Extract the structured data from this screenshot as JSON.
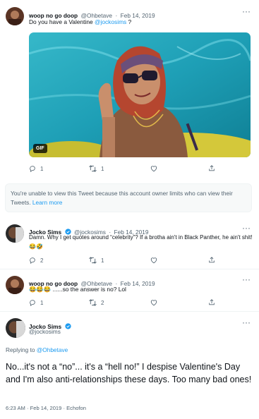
{
  "tweet1": {
    "display_name": "woop no go doop",
    "handle": "@Ohbetave",
    "date": "Feb 14, 2019",
    "text_before": "Do you have a Valentine ",
    "mention": "@jockosims",
    "text_after": " ?",
    "media_badge": "GIF",
    "reply_count": "1",
    "retweet_count": "1",
    "like_count": ""
  },
  "notice": {
    "text": "You're unable to view this Tweet because this account owner limits who can view their Tweets.",
    "link": "Learn more"
  },
  "tweet2": {
    "display_name": "Jocko Sims",
    "handle": "@jockosims",
    "date": "Feb 14, 2019",
    "text": "Damn. Why I get quotes around “celebrity”? If a brotha ain't in Black Panther, he ain't shit! 😂🤣",
    "reply_count": "2",
    "retweet_count": "1"
  },
  "tweet3": {
    "display_name": "woop no go doop",
    "handle": "@Ohbetave",
    "date": "Feb 14, 2019",
    "text": "😂😂😂 ......so the answer is no? Lol",
    "reply_count": "1",
    "retweet_count": "2"
  },
  "main": {
    "display_name": "Jocko Sims",
    "handle": "@jockosims",
    "replying_label": "Replying to ",
    "replying_to": "@Ohbetave",
    "text": "No...it's not a “no”... it's a “hell no!” I despise Valentine's Day and I'm also anti-relationships these days. Too many bad ones!",
    "timestamp": "6:23 AM · Feb 14, 2019 · Echofon"
  },
  "ui": {
    "more_glyph": "···",
    "dot_sep": "·",
    "accent": "#1d9bf0",
    "verified_color": "#1d9bf0",
    "notice_bg": "#f7f9f9"
  }
}
